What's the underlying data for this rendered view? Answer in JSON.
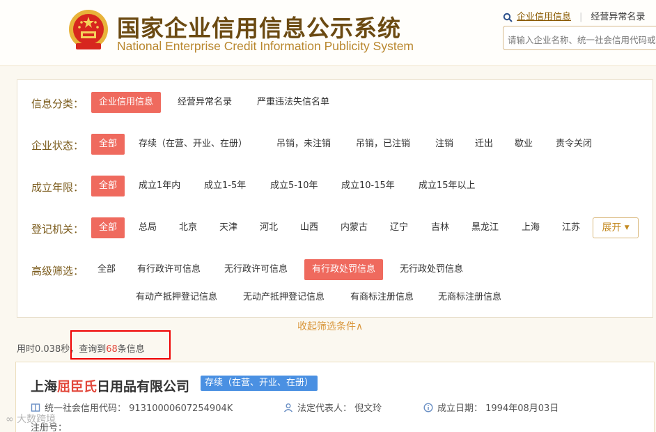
{
  "header": {
    "title_cn": "国家企业信用信息公示系统",
    "title_en": "National Enterprise Credit Information Publicity System",
    "links": {
      "credit_info": "企业信用信息",
      "abnormal": "经营异常名录"
    },
    "search_placeholder": "请输入企业名称、统一社会信用代码或注册号"
  },
  "filters": {
    "category": {
      "label": "信息分类：",
      "options": [
        "企业信用信息",
        "经营异常名录",
        "严重违法失信名单"
      ]
    },
    "status": {
      "label": "企业状态：",
      "options": [
        "全部",
        "存续（在营、开业、在册）",
        "吊销，未注销",
        "吊销，已注销",
        "注销",
        "迁出",
        "歇业",
        "责令关闭"
      ]
    },
    "years": {
      "label": "成立年限：",
      "options": [
        "全部",
        "成立1年内",
        "成立1-5年",
        "成立5-10年",
        "成立10-15年",
        "成立15年以上"
      ]
    },
    "authority": {
      "label": "登记机关：",
      "options": [
        "全部",
        "总局",
        "北京",
        "天津",
        "河北",
        "山西",
        "内蒙古",
        "辽宁",
        "吉林",
        "黑龙江",
        "上海",
        "江苏"
      ],
      "expand": "展开"
    },
    "advanced": {
      "label": "高级筛选：",
      "options": [
        "全部",
        "有行政许可信息",
        "无行政许可信息",
        "有行政处罚信息",
        "无行政处罚信息"
      ],
      "options2": [
        "有动产抵押登记信息",
        "无动产抵押登记信息",
        "有商标注册信息",
        "无商标注册信息"
      ]
    },
    "collapse": "收起筛选条件∧"
  },
  "summary": {
    "prefix": "用时0.038秒，查询到",
    "count": "68",
    "suffix": "条信息"
  },
  "result": {
    "name_pre": "上海",
    "name_hl": "屈臣氏",
    "name_post": "日用品有限公司",
    "status": "存续（在营、开业、在册）",
    "credit_code": "统一社会信用代码： 91310000607254904K",
    "legal_rep": "法定代表人： 倪文玲",
    "established": "成立日期： 1994年08月03日",
    "reg_no": "注册号："
  },
  "watermark": "大数跨境",
  "colors": {
    "accent_red": "#ef6a5e",
    "brand_brown": "#6b4a12",
    "status_blue": "#4a90e2"
  }
}
